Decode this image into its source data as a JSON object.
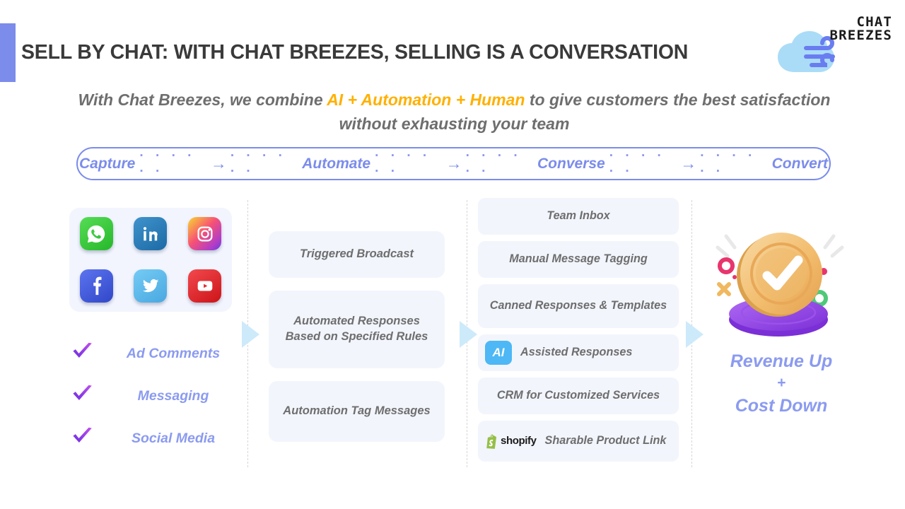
{
  "header": {
    "title": "SELL BY CHAT: WITH CHAT BREEZES, SELLING IS A CONVERSATION",
    "accent_color": "#7b8ceb",
    "logo": {
      "line1": "CHAT",
      "line2": "BREEZES",
      "mark_name": "cloud-breeze-icon",
      "cloud_color": "#aadcf7",
      "wind_color": "#6a7df0"
    }
  },
  "subtitle": {
    "before": "With Chat Breezes, we combine ",
    "highlight": "AI + Automation + Human",
    "after": " to give customers the best satisfaction without exhausting your team",
    "highlight_color": "#ffb000",
    "text_color": "#6e6e6e"
  },
  "pipeline": {
    "steps": [
      "Capture",
      "Automate",
      "Converse",
      "Convert"
    ],
    "dots": "· · · · · ·",
    "arrow": "→",
    "color": "#7b8ceb"
  },
  "column1": {
    "socials": [
      {
        "name": "whatsapp-icon",
        "label": "WhatsApp",
        "color": "#3ecf3e"
      },
      {
        "name": "linkedin-icon",
        "label": "LinkedIn",
        "color": "#2b7bb9"
      },
      {
        "name": "instagram-icon",
        "label": "Instagram",
        "color": "#d62976"
      },
      {
        "name": "facebook-icon",
        "label": "Facebook",
        "color": "#4a62e0"
      },
      {
        "name": "twitter-icon",
        "label": "Twitter",
        "color": "#61c0f0"
      },
      {
        "name": "youtube-icon",
        "label": "YouTube",
        "color": "#e8252a"
      }
    ],
    "checklist": [
      "Ad Comments",
      "Messaging",
      "Social Media"
    ],
    "check_color": "#9b3df0",
    "label_color": "#8b9bf0"
  },
  "column2": {
    "cards": [
      "Triggered Broadcast",
      "Automated Responses Based on Specified Rules",
      "Automation Tag Messages"
    ]
  },
  "column3": {
    "cards": [
      {
        "label": "Team Inbox",
        "icon": null
      },
      {
        "label": "Manual Message Tagging",
        "icon": null
      },
      {
        "label": "Canned Responses & Templates",
        "icon": null
      },
      {
        "label": "Assisted Responses",
        "icon": "ai-badge",
        "icon_text": "AI",
        "icon_color": "#4db8f5"
      },
      {
        "label": "CRM for Customized Services",
        "icon": null
      },
      {
        "label": "Sharable Product Link",
        "icon": "shopify-logo",
        "icon_text": "shopify",
        "icon_color": "#95bf47"
      }
    ]
  },
  "column4": {
    "illustration": "coin-check-icon",
    "line1": "Revenue Up",
    "plus": "+",
    "line2": "Cost Down",
    "text_color": "#8b9bf0",
    "coin_color": "#f2c078",
    "platform_color": "#9b4ff0"
  },
  "theme": {
    "card_bg": "#f2f5fc",
    "arrow_color": "#cdeafb",
    "divider_color": "#d6d6d6",
    "background": "#ffffff"
  }
}
